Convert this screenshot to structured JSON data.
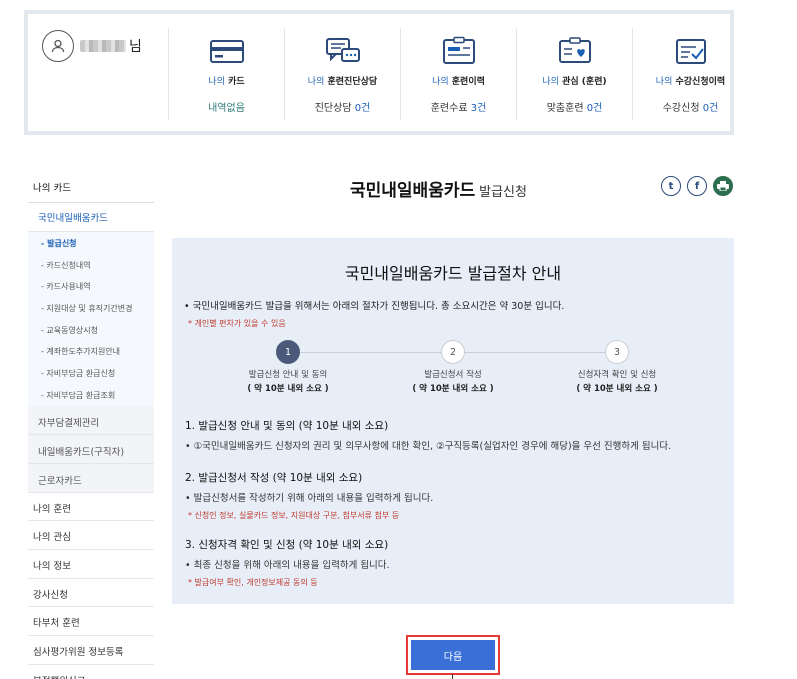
{
  "user": {
    "suffix": "님"
  },
  "stats": [
    {
      "prefix": "나의",
      "title": "카드",
      "value_text": "내역없음",
      "value_num": ""
    },
    {
      "prefix": "나의",
      "title": "훈련진단상담",
      "value_text": "진단상담 ",
      "value_num": "0건"
    },
    {
      "prefix": "나의",
      "title": "훈련이력",
      "value_text": "훈련수료 ",
      "value_num": "3건"
    },
    {
      "prefix": "나의",
      "title": "관심 (훈련)",
      "value_text": "맞춤훈련 ",
      "value_num": "0건"
    },
    {
      "prefix": "나의",
      "title": "수강신청이력",
      "value_text": "수강신청 ",
      "value_num": "0건"
    }
  ],
  "sidebar": {
    "top": "나의 카드",
    "sub": "국민내일배움카드",
    "items": [
      "- 발급신청",
      "- 카드신청내역",
      "- 카드사용내역",
      "- 지원대상 및 휴직기간변경",
      "- 교육동영상시청",
      "- 계좌한도추가지원안내",
      "- 자비부담금 환급신청",
      "- 자비부담금 환급조회"
    ],
    "grey": [
      "자부담결제관리",
      "내일배움카드(구직자)",
      "근로자카드"
    ],
    "main": [
      "나의 훈련",
      "나의 관심",
      "나의 정보",
      "강사신청",
      "타부처 훈련",
      "심사평가위원 정보등록",
      "부정행위신고"
    ]
  },
  "page": {
    "title": "국민내일배움카드",
    "subtitle": "발급신청"
  },
  "share": {
    "twitter": "t",
    "facebook": "f"
  },
  "guide": {
    "title": "국민내일배움카드 발급절차 안내",
    "intro": "• 국민내일배움카드 발급을 위해서는 아래의 절차가 진행됩니다. 총 소요시간은 약 30분 입니다.",
    "note": "* 개인별 편차가 있을 수 있음",
    "steps": [
      {
        "num": "1",
        "label": "발급신청 안내 및 동의",
        "time": "( 약 10분 내외 소요 )"
      },
      {
        "num": "2",
        "label": "발급신청서 작성",
        "time": "( 약 10분 내외 소요 )"
      },
      {
        "num": "3",
        "label": "신청자격 확인 및 신청",
        "time": "( 약 10분 내외 소요 )"
      }
    ],
    "sections": [
      {
        "heading": "1. 발급신청 안내 및 동의 (약 10분 내외 소요)",
        "body": "• ①국민내일배움카드 신청자의 권리 및 의무사항에 대한 확인, ②구직등록(실업자인 경우에 해당)을 우선 진행하게 됩니다.",
        "note": ""
      },
      {
        "heading": "2. 발급신청서 작성 (약 10분 내외 소요)",
        "body": "• 발급신청서를 작성하기 위해 아래의 내용을 입력하게 됩니다.",
        "note": "* 신청인 정보, 실물카드 정보, 지원대상 구분, 첨부서류 첨부 등"
      },
      {
        "heading": "3. 신청자격 확인 및 신청 (약 10분 내외 소요)",
        "body": "• 최종 신청을 위해 아래의 내용을 입력하게 됩니다.",
        "note": "* 발급여부 확인, 개인정보제공 동의 등"
      }
    ]
  },
  "next_button": "다음"
}
